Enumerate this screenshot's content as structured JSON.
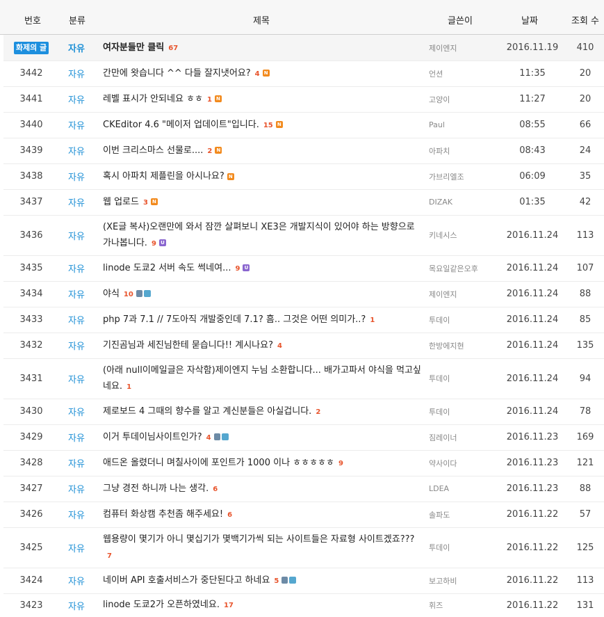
{
  "header": {
    "num": "번호",
    "category": "분류",
    "title": "제목",
    "author": "글쓴이",
    "date": "날짜",
    "views": "조회 수"
  },
  "icons": {
    "new": "new-icon",
    "updated": "updated-icon",
    "file": "file-attachment-icon",
    "image": "image-attachment-icon"
  },
  "colors": {
    "category": "#1e90d6",
    "comment_count": "#e8542c",
    "new_icon": "#f28a1d",
    "updated_icon": "#8a66cf",
    "badge": "#1d8fde"
  },
  "rows": [
    {
      "num": "",
      "badge": "화제의 글",
      "cat": "자유",
      "title": "여자분들만 클릭",
      "comments": "67",
      "icons": [],
      "author": "제이엔지",
      "date": "2016.11.19",
      "views": "410"
    },
    {
      "num": "3442",
      "cat": "자유",
      "title": "간만에 왓습니다 ^^ 다들 잘지냇어요?",
      "comments": "4",
      "icons": [
        "new"
      ],
      "author": "언션",
      "date": "11:35",
      "views": "20"
    },
    {
      "num": "3441",
      "cat": "자유",
      "title": "레벨 표시가 안되네요 ㅎㅎ",
      "comments": "1",
      "icons": [
        "new"
      ],
      "author": "고양이",
      "date": "11:27",
      "views": "20"
    },
    {
      "num": "3440",
      "cat": "자유",
      "title": "CKEditor 4.6 \"메이저 업데이트\"입니다.",
      "comments": "15",
      "icons": [
        "new"
      ],
      "author": "Paul",
      "date": "08:55",
      "views": "66"
    },
    {
      "num": "3439",
      "cat": "자유",
      "title": "이번 크리스마스 선물로....",
      "comments": "2",
      "icons": [
        "new"
      ],
      "author": "아파치",
      "date": "08:43",
      "views": "24"
    },
    {
      "num": "3438",
      "cat": "자유",
      "title": "혹시 아파치 제플린을 아시나요?",
      "comments": "",
      "icons": [
        "new"
      ],
      "author": "가브리엘조",
      "date": "06:09",
      "views": "35"
    },
    {
      "num": "3437",
      "cat": "자유",
      "title": "웹 업로드",
      "comments": "3",
      "icons": [
        "new"
      ],
      "author": "DIZAK",
      "date": "01:35",
      "views": "42"
    },
    {
      "num": "3436",
      "cat": "자유",
      "title": "(XE글 복사)오랜만에 와서 잠깐 살펴보니 XE3은 개발지식이 있어야 하는 방향으로 가나봅니다.",
      "comments": "9",
      "icons": [
        "updated"
      ],
      "author": "키네시스",
      "date": "2016.11.24",
      "views": "113"
    },
    {
      "num": "3435",
      "cat": "자유",
      "title": "linode 도쿄2 서버 속도 썩네여...",
      "comments": "9",
      "icons": [
        "updated"
      ],
      "author": "목요일같은오후",
      "date": "2016.11.24",
      "views": "107"
    },
    {
      "num": "3434",
      "cat": "자유",
      "title": "야식",
      "comments": "10",
      "icons": [
        "file",
        "image"
      ],
      "author": "제이엔지",
      "date": "2016.11.24",
      "views": "88"
    },
    {
      "num": "3433",
      "cat": "자유",
      "title": "php 7과 7.1 // 7도아직 개발중인데 7.1? 흠.. 그것은 어떤 의미가..?",
      "comments": "1",
      "icons": [],
      "author": "투데이",
      "date": "2016.11.24",
      "views": "85"
    },
    {
      "num": "3432",
      "cat": "자유",
      "title": "기진곰님과 세진님한테 묻습니다!! 계시나요?",
      "comments": "4",
      "icons": [],
      "author": "한방에지현",
      "date": "2016.11.24",
      "views": "135"
    },
    {
      "num": "3431",
      "cat": "자유",
      "title": "(아래 null이메일글은 자삭함)제이엔지 누님 소환합니다... 배가고파서 야식을 먹고싶네요.",
      "comments": "1",
      "icons": [],
      "author": "투데이",
      "date": "2016.11.24",
      "views": "94"
    },
    {
      "num": "3430",
      "cat": "자유",
      "title": "제로보드 4 그때의 향수를 알고 계신분들은 아실겁니다.",
      "comments": "2",
      "icons": [],
      "author": "투데이",
      "date": "2016.11.24",
      "views": "78"
    },
    {
      "num": "3429",
      "cat": "자유",
      "title": "이거 투데이님사이트인가?",
      "comments": "4",
      "icons": [
        "file",
        "image"
      ],
      "author": "짐레이너",
      "date": "2016.11.23",
      "views": "169"
    },
    {
      "num": "3428",
      "cat": "자유",
      "title": "애드온 올렸더니 며칠사이에 포인트가 1000 이나 ㅎㅎㅎㅎㅎ",
      "comments": "9",
      "icons": [],
      "author": "약사이다",
      "date": "2016.11.23",
      "views": "121"
    },
    {
      "num": "3427",
      "cat": "자유",
      "title": "그냥 경전 하니까 나는 생각.",
      "comments": "6",
      "icons": [],
      "author": "LDEA",
      "date": "2016.11.23",
      "views": "88"
    },
    {
      "num": "3426",
      "cat": "자유",
      "title": "컴퓨터 화상캠 추천좀 해주세요!",
      "comments": "6",
      "icons": [],
      "author": "솔파도",
      "date": "2016.11.22",
      "views": "57"
    },
    {
      "num": "3425",
      "cat": "자유",
      "title": "웹용량이 몇기가 아니 몇십기가 몇백기가씩 되는 사이트들은 자료형 사이트겠죠???",
      "comments": "7",
      "icons": [],
      "author": "투데이",
      "date": "2016.11.22",
      "views": "125"
    },
    {
      "num": "3424",
      "cat": "자유",
      "title": "네이버 API 호출서비스가 중단된다고 하네요",
      "comments": "5",
      "icons": [
        "file",
        "image"
      ],
      "author": "보고하비",
      "date": "2016.11.22",
      "views": "113"
    },
    {
      "num": "3423",
      "cat": "자유",
      "title": "linode 도쿄2가 오픈하였네요.",
      "comments": "17",
      "icons": [],
      "author": "휘즈",
      "date": "2016.11.22",
      "views": "131"
    }
  ]
}
